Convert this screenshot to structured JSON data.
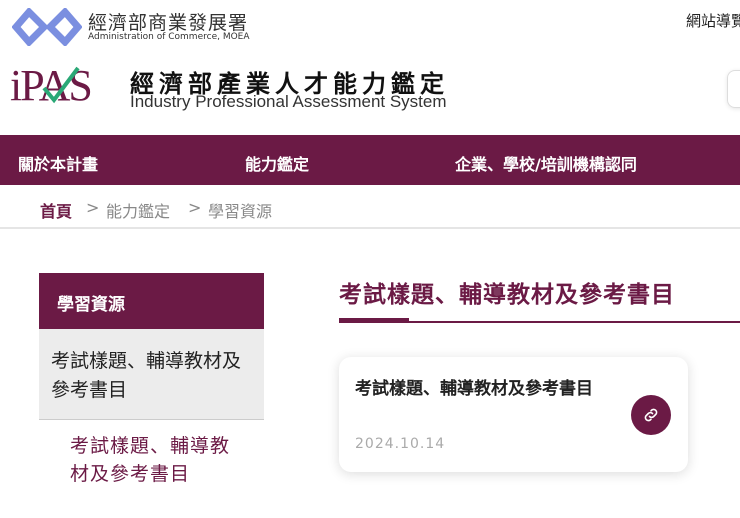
{
  "header": {
    "agency_zh": "經濟部商業發展署",
    "agency_en": "Administration of Commerce, MOEA",
    "sitemap": "網站導覽",
    "brand_logo": "iPAS",
    "system_zh": "經濟部產業人才能力鑑定",
    "system_en": "Industry Professional Assessment System"
  },
  "nav": [
    "關於本計畫",
    "能力鑑定",
    "企業、學校/培訓機構認同"
  ],
  "breadcrumb": {
    "home": "首頁",
    "sep": ">",
    "level1": "能力鑑定",
    "level2": "學習資源"
  },
  "sidebar": {
    "heading": "學習資源",
    "item": "考試樣題、輔導教材及參考書目",
    "subitem": "考試樣題、輔導教材及參考書目"
  },
  "main": {
    "title": "考試樣題、輔導教材及參考書目",
    "card": {
      "title": "考試樣題、輔導教材及參考書目",
      "date": "2024.10.14"
    }
  },
  "colors": {
    "brand": "#6b1a45"
  }
}
